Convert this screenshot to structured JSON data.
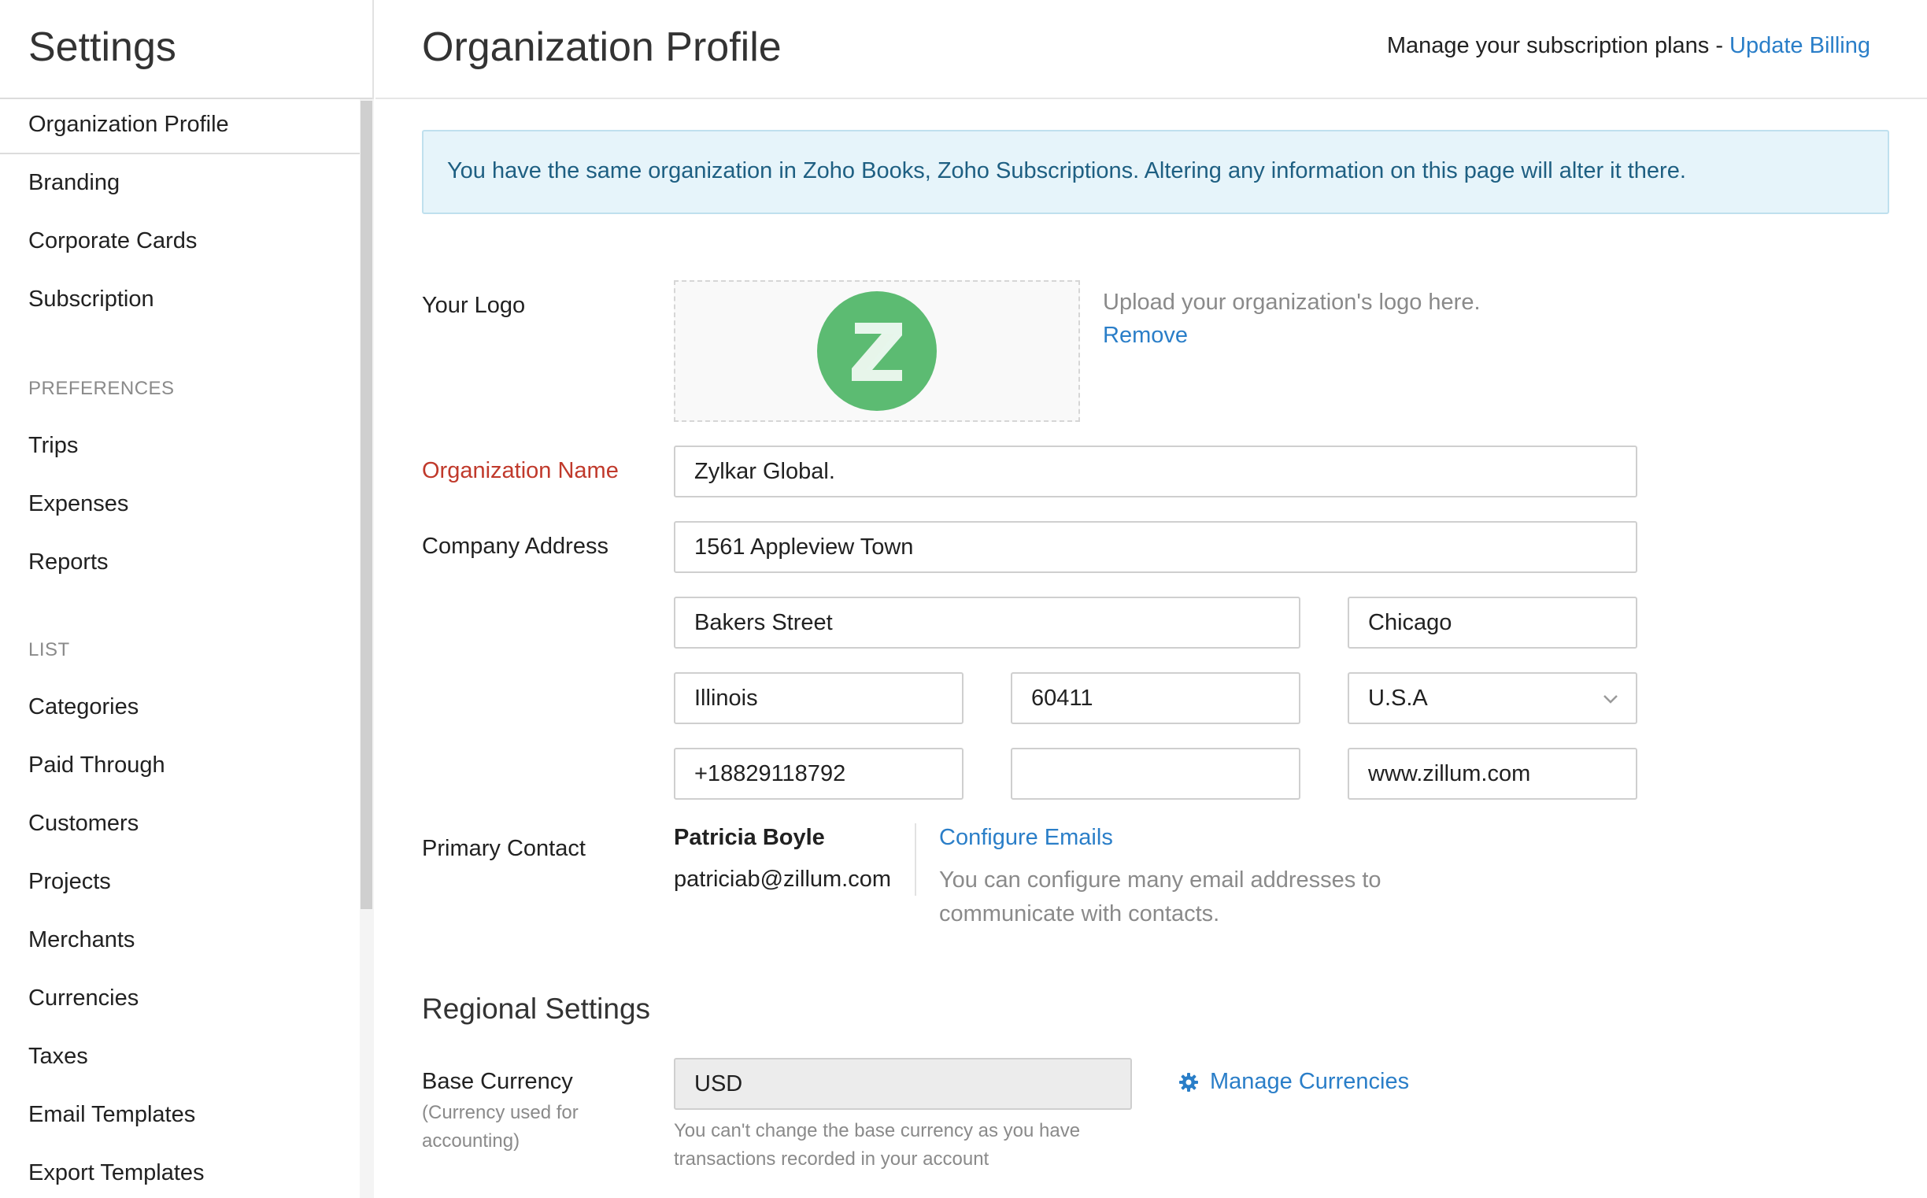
{
  "sidebar": {
    "title": "Settings",
    "items": [
      {
        "label": "Organization Profile"
      },
      {
        "label": "Branding"
      },
      {
        "label": "Corporate Cards"
      },
      {
        "label": "Subscription"
      }
    ],
    "sections": [
      {
        "title": "PREFERENCES",
        "items": [
          {
            "label": "Trips"
          },
          {
            "label": "Expenses"
          },
          {
            "label": "Reports"
          }
        ]
      },
      {
        "title": "LIST",
        "items": [
          {
            "label": "Categories"
          },
          {
            "label": "Paid Through"
          },
          {
            "label": "Customers"
          },
          {
            "label": "Projects"
          },
          {
            "label": "Merchants"
          },
          {
            "label": "Currencies"
          },
          {
            "label": "Taxes"
          },
          {
            "label": "Email Templates"
          },
          {
            "label": "Export Templates"
          }
        ]
      }
    ],
    "active_item": "Organization Profile"
  },
  "header": {
    "title": "Organization Profile",
    "billing_text": "Manage your subscription plans -",
    "billing_link": "Update Billing"
  },
  "banner": {
    "text": "You have the same organization in Zoho Books, Zoho Subscriptions. Altering any information on this page will alter it there."
  },
  "logo": {
    "label": "Your Logo",
    "hint": "Upload your organization's logo here.",
    "remove_label": "Remove",
    "letter": "Z",
    "color": "#5cbb72"
  },
  "form": {
    "org_name_label": "Organization Name",
    "org_name": "Zylkar Global.",
    "address_label": "Company Address",
    "address_line1": "1561 Appleview Town",
    "address_line2": "Bakers Street",
    "city": "Chicago",
    "state": "Illinois",
    "zip": "60411",
    "country": "U.S.A",
    "phone": "+18829118792",
    "fax": "",
    "website": "www.zillum.com"
  },
  "primary_contact": {
    "label": "Primary Contact",
    "name": "Patricia Boyle",
    "email": "patriciab@zillum.com",
    "configure_label": "Configure Emails",
    "configure_help": "You can configure many email addresses to communicate with contacts."
  },
  "regional": {
    "title": "Regional Settings",
    "base_currency_label": "Base Currency",
    "base_currency_sublabel": "(Currency used for accounting)",
    "base_currency": "USD",
    "manage_currencies_label": "Manage Currencies",
    "currency_help": "You can't change the base currency as you have transactions recorded in your account"
  },
  "colors": {
    "link": "#2a7ec8",
    "required": "#c0392b",
    "banner_bg": "#e6f4fa",
    "banner_text": "#1e5f82"
  }
}
